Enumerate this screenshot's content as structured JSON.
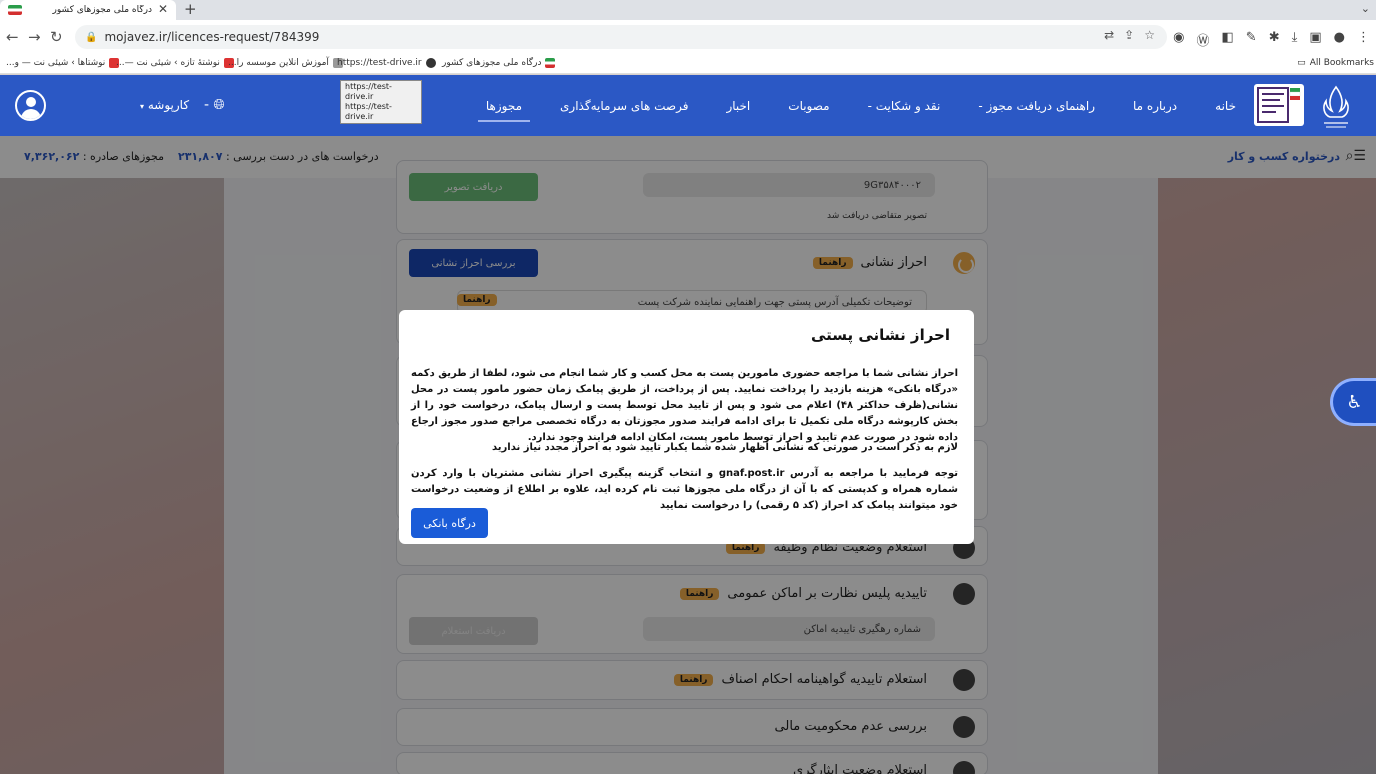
{
  "browser": {
    "tab_title": "درگاه ملی مجوزهای کشور",
    "tab_close": "✕",
    "new_tab": "+",
    "url": "mojavez.ir/licences-request/784399",
    "bookmarks": [
      "نوشتاها › شیئی نت — و...",
      "نوشتهٔ تازه › شیئی نت —...",
      "آموزش انلاین موسسه را...",
      "https://test-drive.ir",
      "درگاه ملی مجوزهای کشور"
    ],
    "all_bookmarks": "All Bookmarks"
  },
  "tooltip": {
    "line1": "https://test-drive.ir",
    "line2": "https://test-drive.ir"
  },
  "header": {
    "nav": [
      {
        "label": "خانه"
      },
      {
        "label": "درباره ما"
      },
      {
        "label": "راهنمای دریافت مجوز -"
      },
      {
        "label": "نقد و شکایت -"
      },
      {
        "label": "مصوبات"
      },
      {
        "label": "اخبار"
      },
      {
        "label": "فرصت های سرمایه‌گذاری"
      },
      {
        "label": "مجوزها"
      }
    ],
    "language_label": "-",
    "karboshe": "کارپوشه"
  },
  "subheader": {
    "title": "درختواره کسب و کار",
    "pending_label": "درخواست های در دست بررسی :",
    "pending_value": "۲۳۱,۸۰۷",
    "issued_label": "مجوزهای صادره :",
    "issued_value": "۷,۳۶۲,۰۶۲"
  },
  "cards": {
    "photo": {
      "field_value": "9G۳۵۸۴۰۰۰۲",
      "received_label": "تصویر متقاضی دریافت شد",
      "button": "دریافت تصویر"
    },
    "address": {
      "title": "احراز نشانی",
      "badge": "راهنما",
      "button": "بررسی احراز نشانی",
      "field_placeholder": "توضیحات تکمیلی آدرس پستی جهت راهنمایی نماینده شرکت پست",
      "field_badge": "راهنما"
    },
    "duty": {
      "title": "استعلام وضعیت نظام وظیفه",
      "badge": "راهنما"
    },
    "police": {
      "title": "تاییدیه پلیس نظارت بر اماکن عمومی",
      "badge": "راهنما",
      "field": "شماره رهگیری تاییدیه اماکن",
      "button": "دریافت استعلام"
    },
    "guild": {
      "title": "استعلام تاییدیه گواهینامه احکام اصناف",
      "badge": "راهنما"
    },
    "finance": {
      "title": "بررسی عدم محکومیت مالی"
    },
    "sacrifice": {
      "title": "استعلام وضعیت ایثارگری"
    }
  },
  "modal": {
    "title": "احراز نشانی پستی",
    "paragraph1": "احراز نشانی شما با مراجعه حضوری مامورین پست به محل کسب و کار شما انجام می شود، لطفا از طریق دکمه «درگاه بانکی» هزینه بازدید را پرداخت نمایید. پس از پرداخت، از طریق پیامک زمان حضور مامور پست در محل نشانی(ظرف حداکثر ۴۸) اعلام می شود و پس از تایید محل توسط پست و ارسال پیامک، درخواست خود را از بخش کارپوشه درگاه ملی تکمیل تا برای ادامه فرایند صدور مجوزتان به درگاه تخصصی مراجع صدور مجوز ارجاع داده شود در صورت عدم تایید و احراز توسط مامور پست، امکان ادامه فرایند وجود ندارد.",
    "paragraph2": "لازم به ذکر است در صورتی که نشانی اظهار شده شما یکبار تایید شود به احراز مجدد نیاز ندارید",
    "paragraph3": "توجه فرمایید با مراجعه به آدرس gnaf.post.ir و انتخاب گزینه پیگیری احراز نشانی مشتریان با وارد کردن شماره همراه و کدپستی که با آن از درگاه ملی مجوزها ثبت نام کرده اید، علاوه بر اطلاع از وضعیت درخواست خود میتوانند پیامک کد احراز (کد ۵ رقمی) را درخواست نمایید",
    "button": "درگاه بانکی"
  }
}
